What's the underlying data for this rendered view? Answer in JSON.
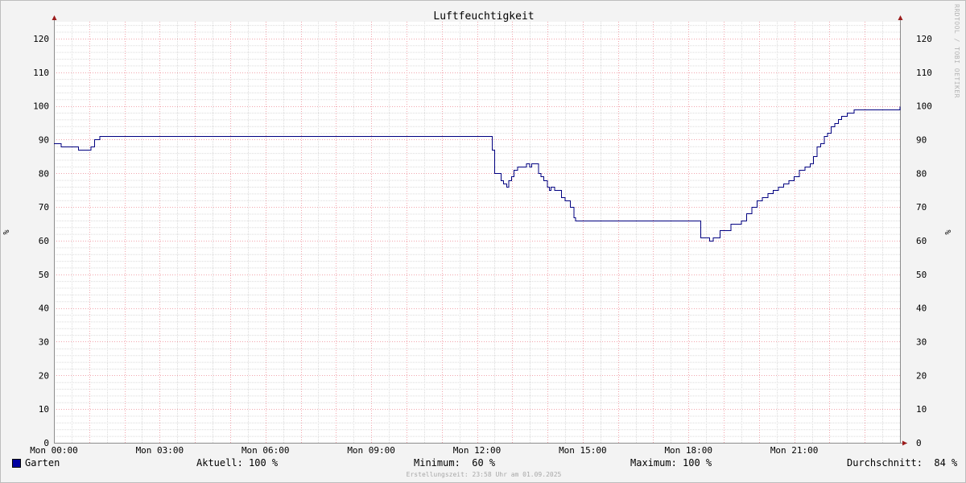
{
  "chart_data": {
    "type": "line",
    "title": "Luftfeuchtigkeit",
    "ylabel": "%",
    "ylabel_right": "%",
    "ylim": [
      0,
      125
    ],
    "xlim": [
      0,
      24
    ],
    "y_ticks": [
      0,
      10,
      20,
      30,
      40,
      50,
      60,
      70,
      80,
      90,
      100,
      110,
      120
    ],
    "x_ticks": [
      {
        "value": 0,
        "label": "Mon 00:00"
      },
      {
        "value": 3,
        "label": "Mon 03:00"
      },
      {
        "value": 6,
        "label": "Mon 06:00"
      },
      {
        "value": 9,
        "label": "Mon 09:00"
      },
      {
        "value": 12,
        "label": "Mon 12:00"
      },
      {
        "value": 15,
        "label": "Mon 15:00"
      },
      {
        "value": 18,
        "label": "Mon 18:00"
      },
      {
        "value": 21,
        "label": "Mon 21:00"
      }
    ],
    "grid": true,
    "legend_position": "bottom",
    "series": [
      {
        "name": "Garten",
        "color": "#000080",
        "x": [
          0,
          0.15,
          0.2,
          0.65,
          0.7,
          0.95,
          1.05,
          1.15,
          1.25,
          1.3,
          12.25,
          12.3,
          12.4,
          12.43,
          12.5,
          12.6,
          12.68,
          12.75,
          12.85,
          12.9,
          12.98,
          13.05,
          13.15,
          13.25,
          13.4,
          13.5,
          13.55,
          13.65,
          13.75,
          13.82,
          13.9,
          14.0,
          14.05,
          14.1,
          14.2,
          14.25,
          14.33,
          14.4,
          14.5,
          14.58,
          14.65,
          14.75,
          14.8,
          18.3,
          18.35,
          18.55,
          18.6,
          18.7,
          18.8,
          18.9,
          19.05,
          19.2,
          19.35,
          19.5,
          19.65,
          19.8,
          19.95,
          20.1,
          20.25,
          20.4,
          20.55,
          20.7,
          20.85,
          21.0,
          21.15,
          21.3,
          21.45,
          21.55,
          21.65,
          21.75,
          21.85,
          21.95,
          22.05,
          22.15,
          22.25,
          22.35,
          22.5,
          22.7,
          22.8,
          24.0
        ],
        "values": [
          89,
          89,
          88,
          88,
          87,
          87,
          88,
          90,
          90,
          91,
          91,
          91,
          91,
          87,
          80,
          80,
          78,
          77,
          76,
          78,
          79,
          81,
          82,
          82,
          83,
          82,
          83,
          83,
          80,
          79,
          78,
          76,
          75,
          76,
          75,
          75,
          75,
          73,
          72,
          72,
          70,
          67,
          66,
          66,
          61,
          61,
          60,
          61,
          61,
          63,
          63,
          65,
          65,
          66,
          68,
          70,
          72,
          73,
          74,
          75,
          76,
          77,
          78,
          79,
          81,
          82,
          83,
          85,
          88,
          89,
          91,
          92,
          94,
          95,
          96,
          97,
          98,
          99,
          99,
          100
        ]
      }
    ]
  },
  "vertical_credit": "RRDTOOL / TOBI OETIKER",
  "legend": {
    "series_name": "Garten",
    "swatch_color": "#0000a0",
    "current_label": "Aktuell:",
    "current_value": "100 %",
    "min_label": "Minimum:",
    "min_value": "60 %",
    "max_label": "Maximum:",
    "max_value": "100 %",
    "avg_label": "Durchschnitt:",
    "avg_value": "84 %"
  },
  "footer": "Erstellungszeit: 23:58 Uhr am 01.09.2025"
}
